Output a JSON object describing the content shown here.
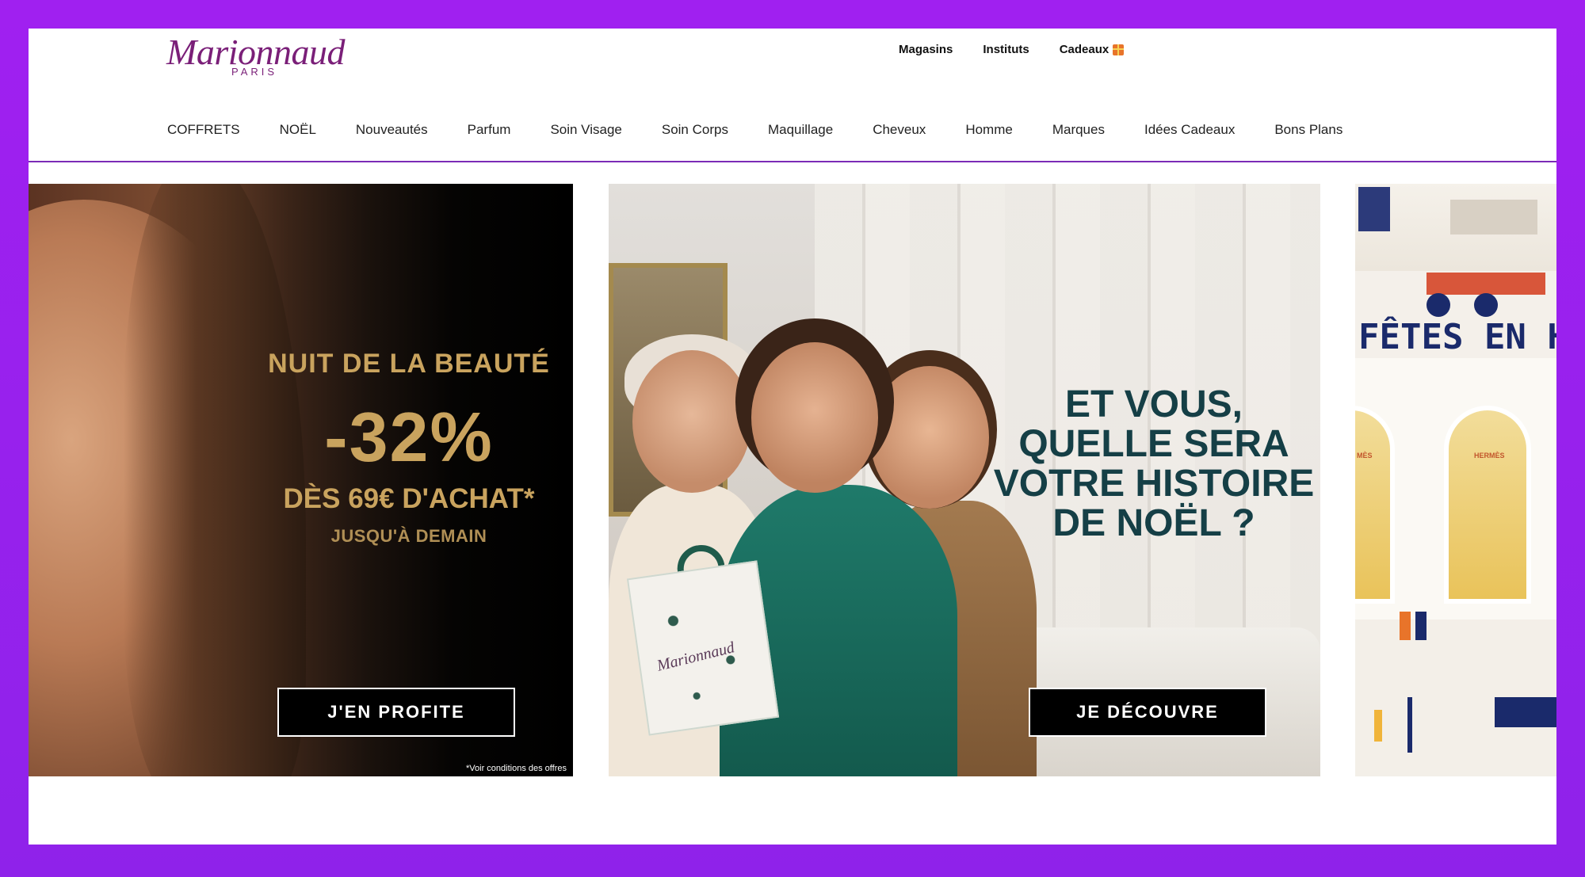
{
  "brand": {
    "name": "Marionnaud",
    "sub": "PARIS"
  },
  "utility_nav": [
    {
      "label": "Magasins"
    },
    {
      "label": "Instituts"
    },
    {
      "label": "Cadeaux",
      "icon": "gift-icon"
    }
  ],
  "main_nav": [
    "COFFRETS",
    "NOËL",
    "Nouveautés",
    "Parfum",
    "Soin Visage",
    "Soin Corps",
    "Maquillage",
    "Cheveux",
    "Homme",
    "Marques",
    "Idées Cadeaux",
    "Bons Plans"
  ],
  "banners": {
    "beauty_night": {
      "eyebrow": "NUIT DE LA BEAUTÉ",
      "discount": "-32%",
      "condition": "DÈS 69€ D'ACHAT*",
      "until": "JUSQU'À DEMAIN",
      "cta": "J'EN PROFITE",
      "footnote": "*Voir conditions des offres"
    },
    "christmas_story": {
      "headline": "ET VOUS, QUELLE SERA VOTRE HISTOIRE DE NOËL ?",
      "bag_brand": "Marionnaud",
      "cta": "JE DÉCOUVRE"
    },
    "hermes_holidays": {
      "title": "FÊTES EN H",
      "sign_left": "MÈS",
      "sign_right": "HERMÈS"
    }
  },
  "colors": {
    "frame": "#a020f0",
    "brand_purple": "#7a1f78",
    "nav_divider": "#7b2bb6",
    "gold_text": "#c9a35e",
    "teal_headline": "#153f46"
  }
}
